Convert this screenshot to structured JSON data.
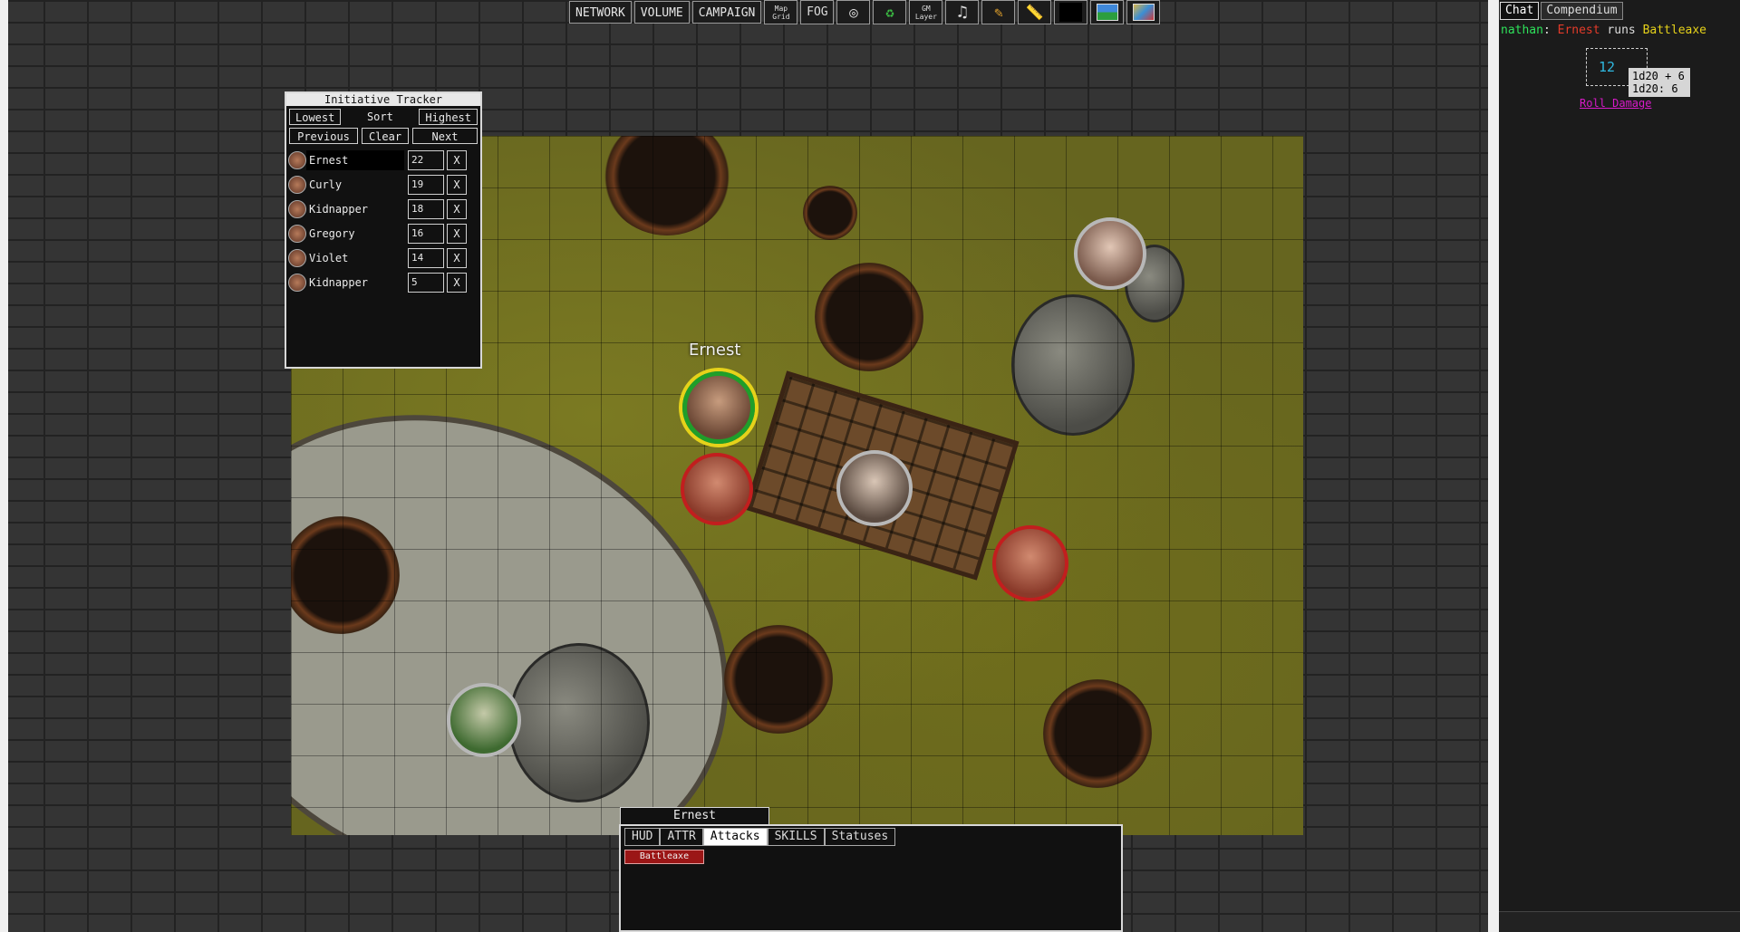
{
  "toolbar": {
    "network": "NETWORK",
    "volume": "VOLUME",
    "campaign": "CAMPAIGN",
    "map_grid": "Map Grid",
    "fog": "FOG",
    "gm_layer": "GM Layer"
  },
  "initiative": {
    "title": "Initiative Tracker",
    "lowest": "Lowest",
    "sort": "Sort",
    "highest": "Highest",
    "previous": "Previous",
    "clear": "Clear",
    "next": "Next",
    "remove": "X",
    "entries": [
      {
        "name": "Ernest",
        "value": "22"
      },
      {
        "name": "Curly",
        "value": "19"
      },
      {
        "name": "Kidnapper",
        "value": "18"
      },
      {
        "name": "Gregory",
        "value": "16"
      },
      {
        "name": "Violet",
        "value": "14"
      },
      {
        "name": "Kidnapper",
        "value": "5"
      }
    ]
  },
  "map": {
    "selected_label": "Ernest"
  },
  "hud": {
    "title": "Ernest",
    "tabs": [
      "HUD",
      "ATTR",
      "Attacks",
      "SKILLS",
      "Statuses"
    ],
    "active_tab": "Attacks",
    "attack": "Battleaxe"
  },
  "chat": {
    "tabs": [
      "Chat",
      "Compendium"
    ],
    "message": {
      "user": "nathan",
      "sep": ": ",
      "actor": "Ernest",
      "verb": " runs ",
      "item": "Battleaxe"
    },
    "roll_total": "12",
    "roll_formula": "1d20 + 6",
    "roll_detail": "1d20: 6",
    "roll_damage": "Roll Damage"
  },
  "colors": {
    "user": "#2ee05a",
    "actor": "#e43b2a",
    "item": "#e6d21a",
    "roll": "#2fb8e0",
    "link": "#d81ac9",
    "ally_ring": "#1f9e2a",
    "enemy_ring": "#c21e1e"
  }
}
